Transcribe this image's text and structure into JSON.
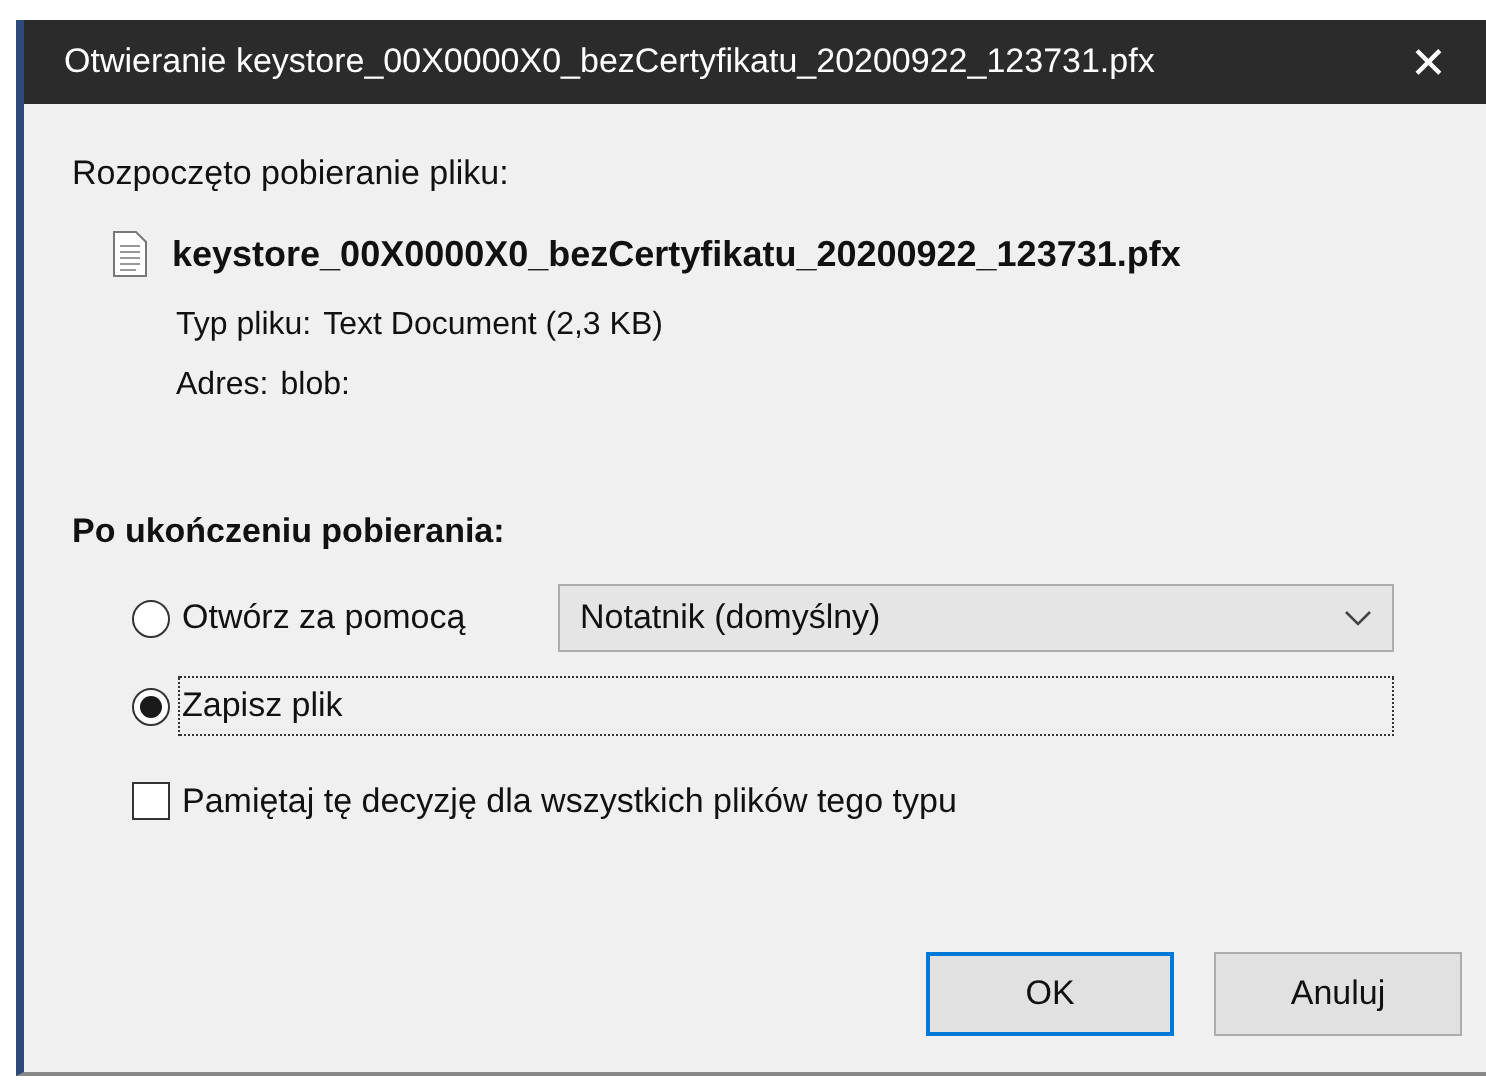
{
  "window": {
    "title": "Otwieranie keystore_00X0000X0_bezCertyfikatu_20200922_123731.pfx",
    "close": "✕"
  },
  "intro": "Rozpoczęto pobieranie pliku:",
  "file": {
    "name": "keystore_00X0000X0_bezCertyfikatu_20200922_123731.pfx",
    "details": [
      {
        "label": "Typ pliku:",
        "value": "Text Document (2,3 KB)"
      },
      {
        "label": "Adres:",
        "value": "blob:"
      }
    ]
  },
  "section": "Po ukończeniu pobierania:",
  "options": [
    {
      "kind": "open-with",
      "label": "Otwórz za pomocą",
      "selected": false,
      "focused": false,
      "dropdown": "Notatnik (domyślny)"
    },
    {
      "kind": "plain",
      "label": "Zapisz plik",
      "selected": true,
      "focused": true
    }
  ],
  "remember": {
    "label": "Pamiętaj tę decyzję dla wszystkich plików tego typu",
    "checked": false
  },
  "buttons": [
    {
      "label": "OK",
      "default": true
    },
    {
      "label": "Anuluj",
      "default": false
    }
  ]
}
